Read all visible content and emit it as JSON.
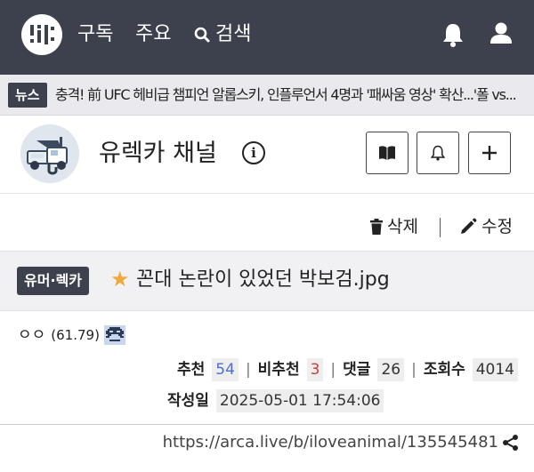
{
  "colors": {
    "nav_bg": "#3d414d",
    "star": "#f0a83a",
    "upvote": "#4a6fd6",
    "downvote": "#c8403a"
  },
  "nav": {
    "logo_icon": "arca-logo-icon",
    "subscribe_label": "구독",
    "popular_label": "주요",
    "search_label": "검색",
    "search_icon": "search-icon",
    "bell_icon": "bell-icon",
    "user_icon": "user-icon"
  },
  "ticker": {
    "badge": "뉴스",
    "text": "충격! 前 UFC 헤비급 챔피언 알롭스키, 인플루언서 4명과 '패싸움 영상' 확산...'폴 vs..."
  },
  "channel": {
    "logo_icon": "tow-truck-logo-icon",
    "name": "유렉카 채널",
    "info_icon": "info-icon",
    "buttons": [
      {
        "icon": "book-icon"
      },
      {
        "icon": "bell-icon"
      },
      {
        "icon": "plus-icon"
      }
    ]
  },
  "actions": {
    "delete_label": "삭제",
    "edit_label": "수정"
  },
  "article": {
    "category": "유머·렉카",
    "star_icon": "star-icon",
    "title": "꼰대 논란이 있었던 박보검.jpg"
  },
  "meta": {
    "author": "ㅇㅇ",
    "author_score": "(61.79)",
    "author_icon": "pixel-avatar-icon",
    "upvote_label": "추천",
    "upvotes": "54",
    "downvote_label": "비추천",
    "downvotes": "3",
    "comments_label": "댓글",
    "comments": "26",
    "views_label": "조회수",
    "views": "4014",
    "date_label": "작성일",
    "date": "2025-05-01 17:54:06",
    "separator": "|"
  },
  "url": "https://arca.live/b/iloveanimal/135545481",
  "share_icon": "share-icon"
}
